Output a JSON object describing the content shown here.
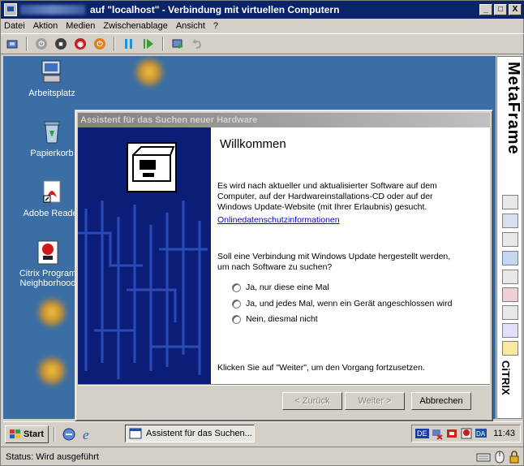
{
  "window": {
    "title": "auf \"localhost\" - Verbindung mit virtuellen Computern",
    "controls": {
      "minimize": "_",
      "maximize": "□",
      "close": "X"
    }
  },
  "menu": {
    "items": [
      "Datei",
      "Aktion",
      "Medien",
      "Zwischenablage",
      "Ansicht",
      "?"
    ]
  },
  "desktop": {
    "icons": [
      {
        "label": "Arbeitsplatz",
        "icon": "my-computer-icon"
      },
      {
        "label": "Papierkorb",
        "icon": "recycle-bin-icon"
      },
      {
        "label": "Adobe Reader",
        "icon": "adobe-reader-icon"
      },
      {
        "label": "Citrix Program Neighborhood",
        "icon": "citrix-program-neighborhood-icon"
      }
    ]
  },
  "dialog": {
    "title": "Assistent für das Suchen neuer Hardware",
    "heading": "Willkommen",
    "intro": "Es wird nach aktueller und aktualisierter Software auf dem Computer, auf der Hardwareinstallations-CD oder auf der Windows Update-Website (mit Ihrer Erlaubnis) gesucht.",
    "privacy_link": "Onlinedatenschutzinformationen",
    "question": "Soll eine Verbindung mit Windows Update hergestellt werden, um nach Software zu suchen?",
    "options": [
      "Ja, nur diese eine Mal",
      "Ja, und jedes Mal, wenn ein Gerät angeschlossen wird",
      "Nein, diesmal nicht"
    ],
    "continue_hint": "Klicken Sie auf \"Weiter\", um den Vorgang fortzusetzen.",
    "buttons": {
      "back": "< Zurück",
      "next": "Weiter >",
      "cancel": "Abbrechen"
    }
  },
  "side_panel": {
    "brand": "MetaFrame",
    "footer": "CiTRIX"
  },
  "taskbar": {
    "start": "Start",
    "task": "Assistent für das Suchen...",
    "language": "DE",
    "clock": "11:43"
  },
  "status": {
    "text": "Status: Wird ausgeführt"
  },
  "colors": {
    "titlebar": "#0a246a",
    "desktop": "#3a6ea5",
    "wizard_panel": "#0a1e78"
  }
}
